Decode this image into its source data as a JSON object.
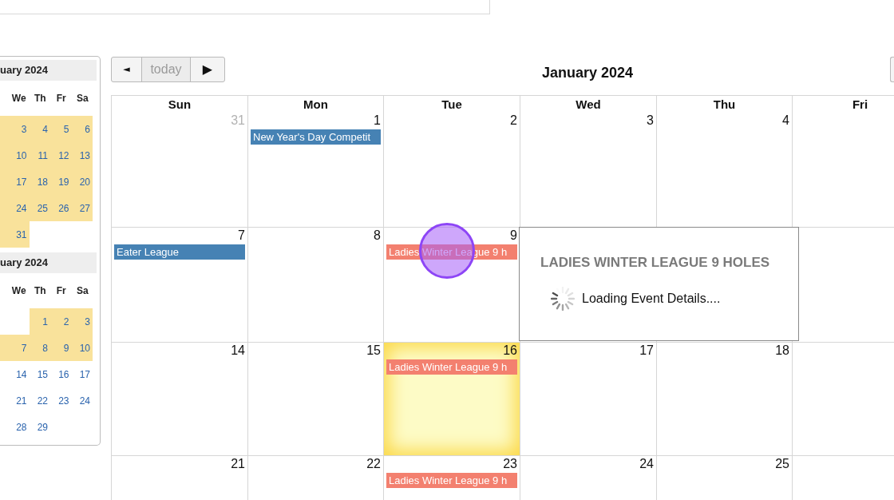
{
  "mini_calendars": [
    {
      "title": "uary 2024",
      "weekdays": [
        "We",
        "Th",
        "Fr",
        "Sa"
      ],
      "weeks": [
        {
          "edge_highlighted": true,
          "days": [
            {
              "kind": "day",
              "day": "3",
              "highlighted": true
            },
            {
              "kind": "day",
              "day": "4",
              "highlighted": true
            },
            {
              "kind": "day",
              "day": "5",
              "highlighted": true
            },
            {
              "kind": "day",
              "day": "6",
              "highlighted": true
            }
          ]
        },
        {
          "edge_highlighted": true,
          "days": [
            {
              "kind": "day",
              "day": "10",
              "highlighted": true
            },
            {
              "kind": "day",
              "day": "11",
              "highlighted": true
            },
            {
              "kind": "day",
              "day": "12",
              "highlighted": true
            },
            {
              "kind": "day",
              "day": "13",
              "highlighted": true
            }
          ]
        },
        {
          "edge_highlighted": true,
          "days": [
            {
              "kind": "day",
              "day": "17",
              "highlighted": true
            },
            {
              "kind": "day",
              "day": "18",
              "highlighted": true
            },
            {
              "kind": "day",
              "day": "19",
              "highlighted": true
            },
            {
              "kind": "day",
              "day": "20",
              "highlighted": true
            }
          ]
        },
        {
          "edge_highlighted": true,
          "days": [
            {
              "kind": "day",
              "day": "24",
              "highlighted": true
            },
            {
              "kind": "day",
              "day": "25",
              "highlighted": true
            },
            {
              "kind": "day",
              "day": "26",
              "highlighted": true
            },
            {
              "kind": "day",
              "day": "27",
              "highlighted": true
            }
          ]
        },
        {
          "edge_highlighted": true,
          "days": [
            {
              "kind": "day",
              "day": "31",
              "highlighted": true
            },
            {
              "kind": "blank"
            },
            {
              "kind": "blank"
            },
            {
              "kind": "blank"
            }
          ]
        }
      ]
    },
    {
      "title": "uary 2024",
      "weekdays": [
        "We",
        "Th",
        "Fr",
        "Sa"
      ],
      "weeks": [
        {
          "edge_highlighted": false,
          "days": [
            {
              "kind": "blank"
            },
            {
              "kind": "day",
              "day": "1",
              "highlighted": true
            },
            {
              "kind": "day",
              "day": "2",
              "highlighted": true
            },
            {
              "kind": "day",
              "day": "3",
              "highlighted": true
            }
          ]
        },
        {
          "edge_highlighted": true,
          "days": [
            {
              "kind": "day",
              "day": "7",
              "highlighted": true
            },
            {
              "kind": "day",
              "day": "8",
              "highlighted": true
            },
            {
              "kind": "day",
              "day": "9",
              "highlighted": true
            },
            {
              "kind": "day",
              "day": "10",
              "highlighted": true
            }
          ]
        },
        {
          "edge_highlighted": false,
          "days": [
            {
              "kind": "day",
              "day": "14",
              "highlighted": false
            },
            {
              "kind": "day",
              "day": "15",
              "highlighted": false
            },
            {
              "kind": "day",
              "day": "16",
              "highlighted": false
            },
            {
              "kind": "day",
              "day": "17",
              "highlighted": false
            }
          ]
        },
        {
          "edge_highlighted": false,
          "days": [
            {
              "kind": "day",
              "day": "21",
              "highlighted": false
            },
            {
              "kind": "day",
              "day": "22",
              "highlighted": false
            },
            {
              "kind": "day",
              "day": "23",
              "highlighted": false
            },
            {
              "kind": "day",
              "day": "24",
              "highlighted": false
            }
          ]
        },
        {
          "edge_highlighted": false,
          "days": [
            {
              "kind": "day",
              "day": "28",
              "highlighted": false
            },
            {
              "kind": "day",
              "day": "29",
              "highlighted": false
            },
            {
              "kind": "blank"
            },
            {
              "kind": "blank"
            }
          ]
        }
      ]
    }
  ],
  "toolbar": {
    "buttons": [
      {
        "kind": "prev",
        "label": "◄",
        "disabled": false
      },
      {
        "kind": "today",
        "label": "today",
        "disabled": true
      },
      {
        "kind": "next",
        "label": "▶",
        "disabled": false
      }
    ],
    "title": "January 2024"
  },
  "calendar": {
    "weekdays": [
      "Sun",
      "Mon",
      "Tue",
      "Wed",
      "Thu",
      "Fri"
    ],
    "weeks": [
      {
        "days": [
          {
            "kind": "day",
            "date": "31",
            "other_month": true,
            "today": false
          },
          {
            "kind": "day",
            "date": "1",
            "other_month": false,
            "today": false,
            "events": [
              {
                "title": "New Year's Day Competit",
                "color": "#4682b4"
              }
            ]
          },
          {
            "kind": "day",
            "date": "2",
            "other_month": false,
            "today": false
          },
          {
            "kind": "day",
            "date": "3",
            "other_month": false,
            "today": false
          },
          {
            "kind": "day",
            "date": "4",
            "other_month": false,
            "today": false
          },
          {
            "kind": "blank"
          }
        ]
      },
      {
        "days": [
          {
            "kind": "day",
            "date": "7",
            "other_month": false,
            "today": false,
            "events": [
              {
                "title": "Eater League",
                "color": "#4682b4"
              }
            ]
          },
          {
            "kind": "day",
            "date": "8",
            "other_month": false,
            "today": false
          },
          {
            "kind": "day",
            "date": "9",
            "other_month": false,
            "today": false,
            "events": [
              {
                "title": "Ladies Winter League 9 h",
                "color": "#f3806f"
              }
            ]
          },
          {
            "kind": "blank"
          },
          {
            "kind": "blank"
          },
          {
            "kind": "blank"
          }
        ]
      },
      {
        "days": [
          {
            "kind": "day",
            "date": "14",
            "other_month": false,
            "today": false
          },
          {
            "kind": "day",
            "date": "15",
            "other_month": false,
            "today": false
          },
          {
            "kind": "day",
            "date": "16",
            "other_month": false,
            "today": true,
            "events": [
              {
                "title": "Ladies Winter League 9 h",
                "color": "#f3806f"
              }
            ]
          },
          {
            "kind": "day",
            "date": "17",
            "other_month": false,
            "today": false
          },
          {
            "kind": "day",
            "date": "18",
            "other_month": false,
            "today": false
          },
          {
            "kind": "blank"
          }
        ]
      },
      {
        "days": [
          {
            "kind": "day",
            "date": "21",
            "other_month": false,
            "today": false
          },
          {
            "kind": "day",
            "date": "22",
            "other_month": false,
            "today": false
          },
          {
            "kind": "day",
            "date": "23",
            "other_month": false,
            "today": false,
            "events": [
              {
                "title": "Ladies Winter League 9 h",
                "color": "#f3806f"
              }
            ]
          },
          {
            "kind": "day",
            "date": "24",
            "other_month": false,
            "today": false
          },
          {
            "kind": "day",
            "date": "25",
            "other_month": false,
            "today": false
          },
          {
            "kind": "blank"
          }
        ]
      }
    ]
  },
  "event_popup": {
    "title": "LADIES WINTER LEAGUE 9 HOLES",
    "message": "Loading Event Details...."
  }
}
